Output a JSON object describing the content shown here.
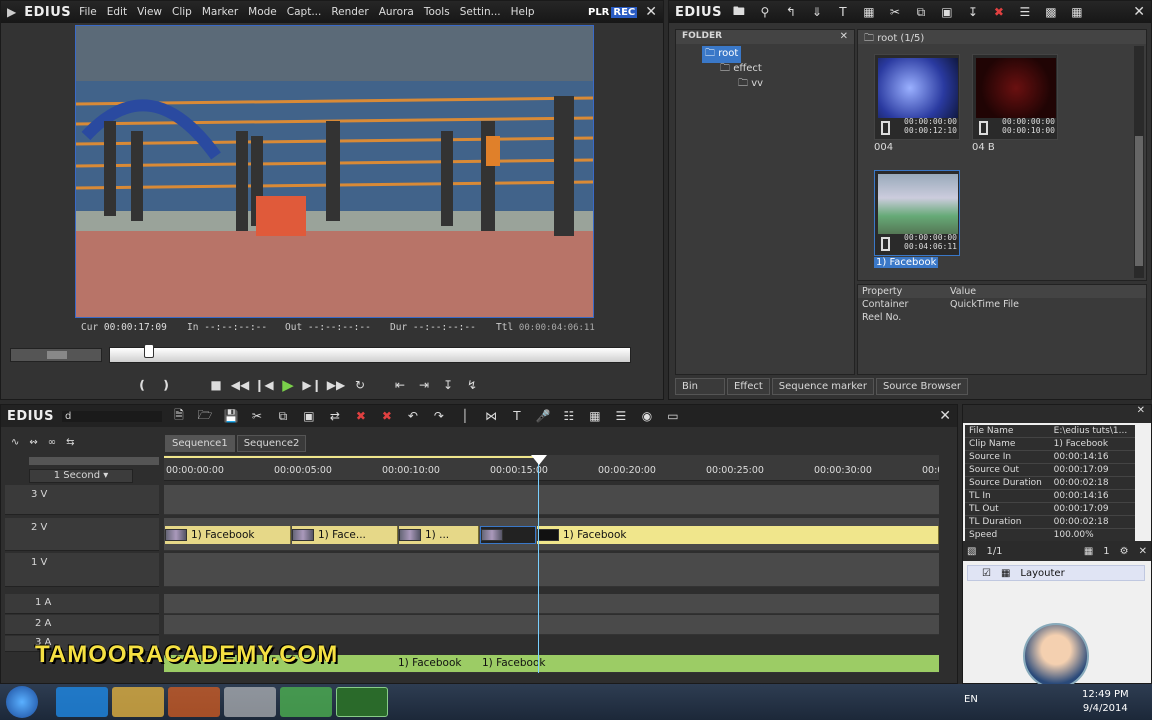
{
  "player": {
    "logo": "EDIUS",
    "menu": [
      "File",
      "Edit",
      "View",
      "Clip",
      "Marker",
      "Mode",
      "Capt...",
      "Render",
      "Aurora",
      "Tools",
      "Settin...",
      "Help"
    ],
    "plr": "PLR",
    "rec": "REC",
    "cur_label": "Cur",
    "cur": "00:00:17:09",
    "in_label": "In",
    "in": "--:--:--:--",
    "out_label": "Out",
    "out": "--:--:--:--",
    "dur_label": "Dur",
    "dur": "--:--:--:--",
    "ttl_label": "Ttl",
    "ttl": "00:00:04:06:11"
  },
  "bin": {
    "logo": "EDIUS",
    "folder_label": "FOLDER",
    "tree": [
      "root",
      "effect",
      "vv"
    ],
    "path": "root (1/5)",
    "clips": [
      {
        "name": "004",
        "tc1": "00:00:00:00",
        "tc2": "00:00:12:10"
      },
      {
        "name": "04 B",
        "tc1": "00:00:00:00",
        "tc2": "00:00:10:00"
      },
      {
        "name": "1) Facebook",
        "tc1": "00:00:00:00",
        "tc2": "00:04:06:11"
      }
    ],
    "prop_header": [
      "Property",
      "Value"
    ],
    "props": [
      [
        "Container",
        "QuickTime File"
      ],
      [
        "Reel No.",
        ""
      ]
    ],
    "tabs": [
      "Bin",
      "Effect",
      "Sequence marker",
      "Source Browser"
    ]
  },
  "timeline": {
    "logo": "EDIUS",
    "project": "d",
    "tabs": [
      "Sequence1",
      "Sequence2"
    ],
    "scale": "1 Second",
    "ruler": [
      "00:00:00:00",
      "00:00:05:00",
      "00:00:10:00",
      "00:00:15:00",
      "00:00:20:00",
      "00:00:25:00",
      "00:00:30:00",
      "00:0"
    ],
    "tracks": [
      "3 V",
      "2 V",
      "1 V",
      "1 A",
      "2 A",
      "3 A"
    ],
    "clips": [
      "1) Facebook",
      "1) Face...",
      "1) ...",
      "1) Facebook"
    ],
    "audio_clips": [
      "1) Facebook",
      "1) Facebook"
    ]
  },
  "info": {
    "rows": [
      [
        "File Name",
        "E:\\edius tuts\\1..."
      ],
      [
        "Clip Name",
        "1) Facebook"
      ],
      [
        "Source In",
        "00:00:14:16"
      ],
      [
        "Source Out",
        "00:00:17:09"
      ],
      [
        "Source Duration",
        "00:00:02:18"
      ],
      [
        "TL In",
        "00:00:14:16"
      ],
      [
        "TL Out",
        "00:00:17:09"
      ],
      [
        "TL Duration",
        "00:00:02:18"
      ],
      [
        "Speed",
        "100.00%"
      ]
    ],
    "count": "1/1",
    "layer_count": "1",
    "layouter": "Layouter"
  },
  "watermark": "TAMOORACADEMY.COM",
  "taskbar": {
    "lang": "EN",
    "time": "12:49 PM",
    "date": "9/4/2014"
  },
  "colors": {
    "accent": "#f0e68c",
    "clip": "#e6d888",
    "audio": "#9ccc65",
    "selection": "#3a78c8"
  }
}
